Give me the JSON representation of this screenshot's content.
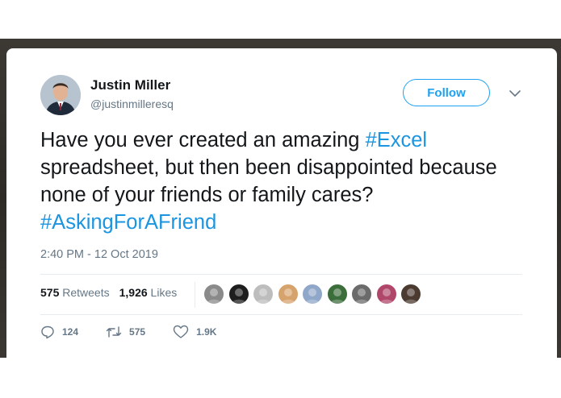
{
  "tweet": {
    "author_name": "Justin Miller",
    "author_handle": "@justinmilleresq",
    "follow_label": "Follow",
    "text_parts": [
      {
        "text": "Have you ever created an amazing ",
        "hashtag": false
      },
      {
        "text": "#Excel",
        "hashtag": true
      },
      {
        "text": " spreadsheet, but then been disappointed because none of your friends or family cares? ",
        "hashtag": false
      },
      {
        "text": "#AskingForAFriend",
        "hashtag": true
      }
    ],
    "timestamp": "2:40 PM - 12 Oct 2019",
    "stats": {
      "retweets_count": "575",
      "retweets_label": "Retweets",
      "likes_count": "1,926",
      "likes_label": "Likes"
    },
    "liker_avatars": [
      {
        "name": "liker-avatar-1",
        "color": "#8a8a8a"
      },
      {
        "name": "liker-avatar-2",
        "color": "#1e1e1e"
      },
      {
        "name": "liker-avatar-3",
        "color": "#bdbdbd"
      },
      {
        "name": "liker-avatar-4",
        "color": "#d7a36c"
      },
      {
        "name": "liker-avatar-5",
        "color": "#8fa7c9"
      },
      {
        "name": "liker-avatar-6",
        "color": "#3c6e3c"
      },
      {
        "name": "liker-avatar-7",
        "color": "#6b6b6b"
      },
      {
        "name": "liker-avatar-8",
        "color": "#b0476b"
      },
      {
        "name": "liker-avatar-9",
        "color": "#4a3a30"
      }
    ],
    "actions": {
      "reply_count": "124",
      "retweet_count": "575",
      "like_count": "1.9K"
    }
  },
  "colors": {
    "accent": "#1da1f2",
    "hashtag": "#1b95e0",
    "muted": "#657786",
    "text": "#14171a"
  },
  "icons": {
    "caret": "chevron-down-icon",
    "reply": "reply-icon",
    "retweet": "retweet-icon",
    "like": "heart-icon"
  }
}
